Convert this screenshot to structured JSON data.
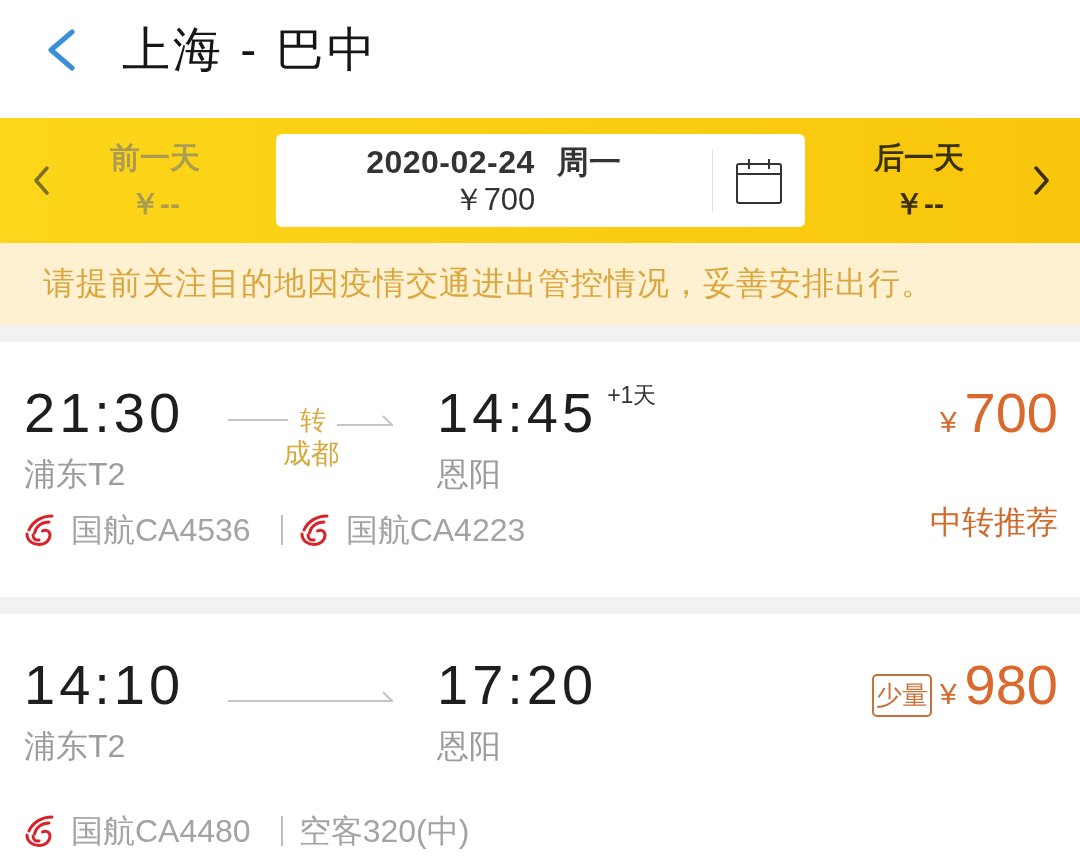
{
  "header": {
    "title": "上海 - 巴中"
  },
  "date_bar": {
    "prev": {
      "label": "前一天",
      "price": "￥--",
      "disabled": true
    },
    "current": {
      "date": "2020-02-24",
      "weekday": "周一",
      "price": "￥700"
    },
    "next": {
      "label": "后一天",
      "price": "￥--",
      "disabled": false
    }
  },
  "notice": "请提前关注目的地因疫情交通进出管控情况，妥善安排出行。",
  "flights": [
    {
      "depart_time": "21:30",
      "depart_airport": "浦东T2",
      "transfer": {
        "label": "转",
        "city": "成都"
      },
      "arrive_time": "14:45",
      "day_offset": "+1天",
      "arrive_airport": "恩阳",
      "currency": "¥",
      "price": "700",
      "tag": "中转推荐",
      "segments": [
        {
          "flight": "国航CA4536"
        },
        {
          "flight": "国航CA4223"
        }
      ]
    },
    {
      "depart_time": "14:10",
      "depart_airport": "浦东T2",
      "arrive_time": "17:20",
      "arrive_airport": "恩阳",
      "badge": "少量",
      "currency": "¥",
      "price": "980",
      "segments": [
        {
          "flight": "国航CA4480"
        }
      ],
      "aircraft": "空客320(中)"
    }
  ]
}
